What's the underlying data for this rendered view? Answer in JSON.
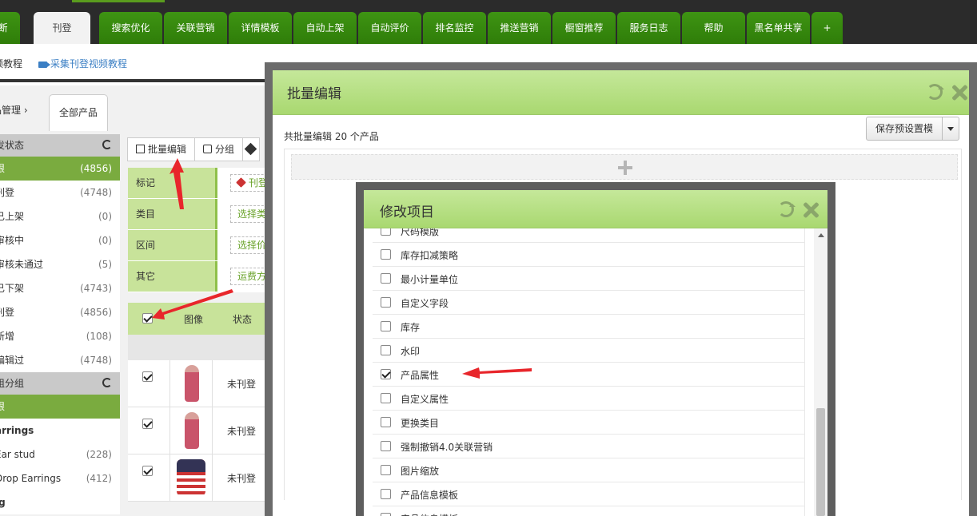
{
  "nav": {
    "tabs": [
      {
        "label": "诊断"
      },
      {
        "label": "刊登"
      },
      {
        "label": "搜索优化"
      },
      {
        "label": "关联营销"
      },
      {
        "label": "详情模板"
      },
      {
        "label": "自动上架"
      },
      {
        "label": "自动评价"
      },
      {
        "label": "排名监控"
      },
      {
        "label": "推送营销"
      },
      {
        "label": "橱窗推荐"
      },
      {
        "label": "服务日志"
      },
      {
        "label": "帮助"
      },
      {
        "label": "黑名单共享"
      },
      {
        "label": "+"
      }
    ]
  },
  "subbar": {
    "link1": "频教程",
    "link2": "采集刊登视频教程"
  },
  "breadcrumb": {
    "item1": "品管理",
    "sep": "›",
    "tab": "全部产品"
  },
  "sidebar": {
    "status_title": "发状态",
    "status_items": [
      {
        "label": "限",
        "count": "(4856)",
        "selected": true
      },
      {
        "label": "刊登",
        "count": "(4748)"
      },
      {
        "label": "已上架",
        "count": "(0)"
      },
      {
        "label": "审核中",
        "count": "(0)"
      },
      {
        "label": "审核未通过",
        "count": "(5)"
      },
      {
        "label": "已下架",
        "count": "(4743)"
      },
      {
        "label": "刊登",
        "count": "(4856)"
      },
      {
        "label": "新增",
        "count": "(108)"
      },
      {
        "label": "编辑过",
        "count": "(4748)"
      }
    ],
    "group_title": "组分组",
    "group_items": [
      {
        "label": "限",
        "count": "",
        "selected": true
      },
      {
        "label": "arrings",
        "count": "",
        "bold": true
      },
      {
        "label": "Ear stud",
        "count": "(228)"
      },
      {
        "label": "Drop Earrings",
        "count": "(412)"
      },
      {
        "label": "ıg",
        "count": "",
        "bold": true
      }
    ]
  },
  "toolbar": {
    "batch_edit": "批量编辑",
    "group": "分组"
  },
  "filter": {
    "rows": [
      {
        "key": "标记",
        "value": "刊登"
      },
      {
        "key": "类目",
        "value": "选择类目"
      },
      {
        "key": "区间",
        "value": "选择价格"
      },
      {
        "key": "其它",
        "value": "运费方式"
      }
    ]
  },
  "grid": {
    "col_image": "图像",
    "col_status": "状态",
    "rows": [
      {
        "status": "未刊登"
      },
      {
        "status": "未刊登"
      },
      {
        "status": "未刊登"
      }
    ]
  },
  "batch_modal": {
    "title": "批量编辑",
    "info": "共批量编辑 20 个产品",
    "preset_button": "保存预设置模"
  },
  "items_modal": {
    "title": "修改项目",
    "items": [
      {
        "label": "尺码模版",
        "checked": false
      },
      {
        "label": "库存扣减策略",
        "checked": false
      },
      {
        "label": "最小计量单位",
        "checked": false
      },
      {
        "label": "自定义字段",
        "checked": false
      },
      {
        "label": "库存",
        "checked": false
      },
      {
        "label": "水印",
        "checked": false
      },
      {
        "label": "产品属性",
        "checked": true
      },
      {
        "label": "自定义属性",
        "checked": false
      },
      {
        "label": "更换类目",
        "checked": false
      },
      {
        "label": "强制撤销4.0关联营销",
        "checked": false
      },
      {
        "label": "图片缩放",
        "checked": false
      },
      {
        "label": "产品信息模板",
        "checked": false
      },
      {
        "label": "产品信息模板",
        "checked": false
      }
    ]
  },
  "colors": {
    "nav_green": "#3e9413",
    "header_green": "#a9d870",
    "selected_green": "#7aab3f",
    "annotation_red": "#e8262b"
  }
}
